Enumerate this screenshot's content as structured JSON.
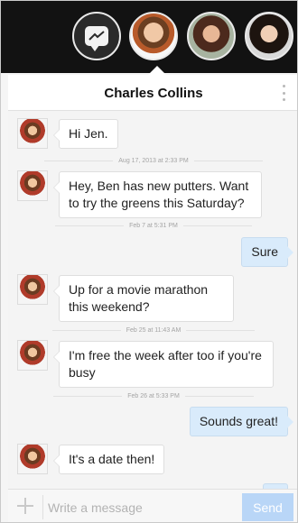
{
  "colors": {
    "top_bar": "#121212",
    "incoming_bubble": "#ffffff",
    "outgoing_bubble": "#d9ebfb",
    "send_button": "#b9d6f7"
  },
  "chat_heads": [
    {
      "name": "messenger-icon"
    },
    {
      "name": "contact-avatar-1"
    },
    {
      "name": "contact-avatar-2"
    },
    {
      "name": "contact-avatar-3"
    }
  ],
  "header": {
    "title": "Charles Collins"
  },
  "messages": [
    {
      "direction": "in",
      "text": "Hi Jen."
    },
    {
      "type": "timestamp",
      "text": "Aug 17, 2013 at 2:33 PM"
    },
    {
      "direction": "in",
      "text": "Hey, Ben has new putters. Want to try the greens this Saturday?"
    },
    {
      "type": "timestamp",
      "text": "Feb 7 at 5:31 PM"
    },
    {
      "direction": "out",
      "text": "Sure"
    },
    {
      "direction": "in",
      "text": "Up for a movie marathon this weekend?"
    },
    {
      "type": "timestamp",
      "text": "Feb 25 at 11:43 AM"
    },
    {
      "direction": "in",
      "text": "I'm free the week after too if you're busy"
    },
    {
      "type": "timestamp",
      "text": "Feb 26 at 5:33 PM"
    },
    {
      "direction": "out",
      "text": "Sounds great!"
    },
    {
      "direction": "in",
      "text": "It's a date then!"
    }
  ],
  "composer": {
    "placeholder": "Write a message",
    "send_label": "Send"
  }
}
